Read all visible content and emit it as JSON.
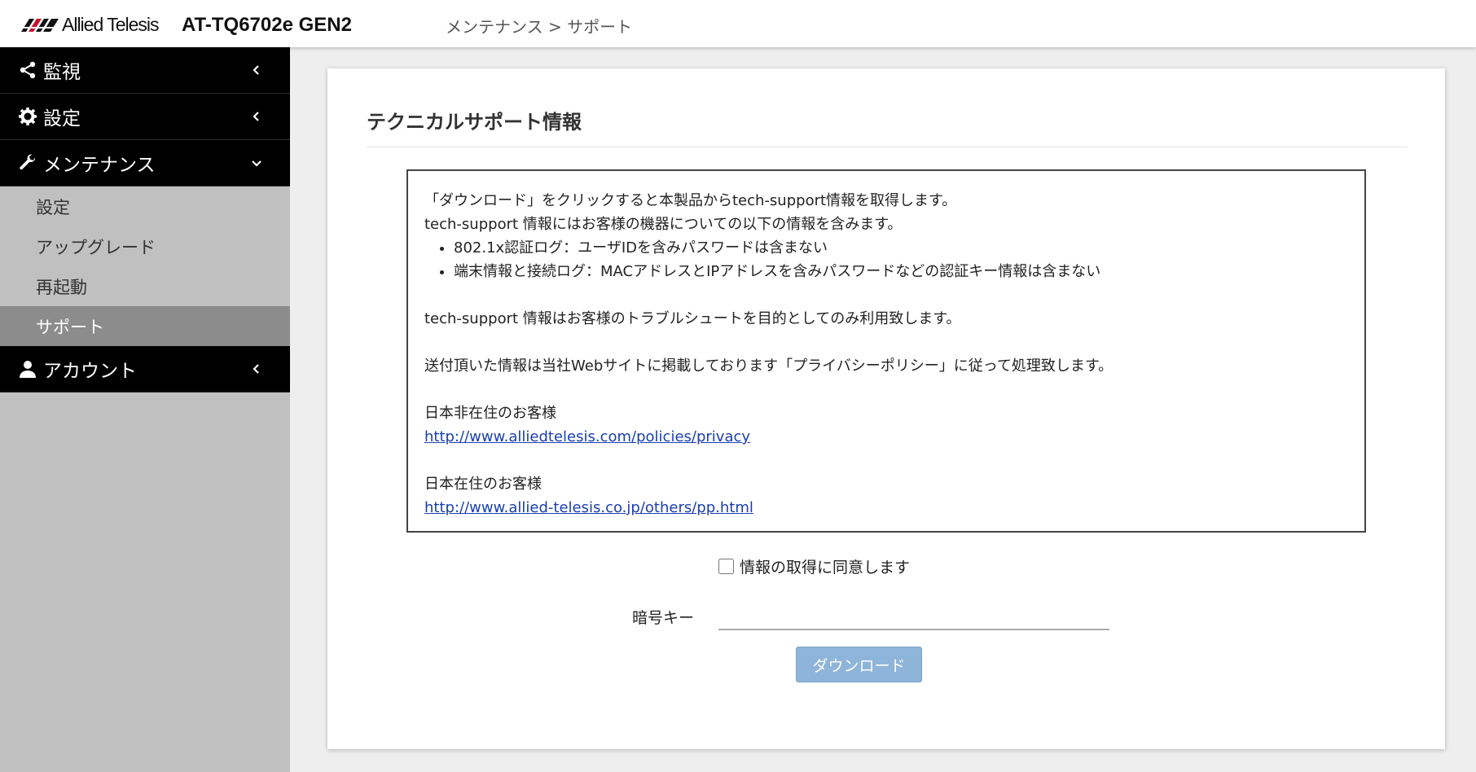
{
  "header": {
    "logo_text": "Allied Telesis",
    "device_name": "AT-TQ6702e GEN2",
    "breadcrumb": "メンテナンス > サポート"
  },
  "sidebar": {
    "items": [
      {
        "label": "監視",
        "icon": "share-icon",
        "expanded": false
      },
      {
        "label": "設定",
        "icon": "gear-icon",
        "expanded": false
      },
      {
        "label": "メンテナンス",
        "icon": "wrench-icon",
        "expanded": true,
        "children": [
          {
            "label": "設定"
          },
          {
            "label": "アップグレード"
          },
          {
            "label": "再起動"
          },
          {
            "label": "サポート",
            "active": true
          }
        ]
      },
      {
        "label": "アカウント",
        "icon": "user-icon",
        "expanded": false
      }
    ]
  },
  "main": {
    "title": "テクニカルサポート情報",
    "notice": {
      "line1": "「ダウンロード」をクリックすると本製品からtech-support情報を取得します。",
      "line2": "tech-support 情報にはお客様の機器についての以下の情報を含みます。",
      "bullets": [
        "802.1x認証ログ：ユーザIDを含みパスワードは含まない",
        "端末情報と接続ログ：MACアドレスとIPアドレスを含みパスワードなどの認証キー情報は含まない"
      ],
      "purpose": "tech-support 情報はお客様のトラブルシュートを目的としてのみ利用致します。",
      "policy": "送付頂いた情報は当社Webサイトに掲載しております「プライバシーポリシー」に従って処理致します。",
      "overseas_label": "日本非在住のお客様",
      "overseas_link": "http://www.alliedtelesis.com/policies/privacy",
      "domestic_label": "日本在住のお客様",
      "domestic_link": "http://www.allied-telesis.co.jp/others/pp.html"
    },
    "agree_label": "情報の取得に同意します",
    "agree_checked": false,
    "key_label": "暗号キー",
    "key_value": "",
    "download_label": "ダウンロード"
  },
  "colors": {
    "sidebar_bg": "#c0c0c0",
    "nav_bg": "#000000",
    "active_sub_bg": "#8c8c8c",
    "button_bg": "#8fb4d9",
    "link": "#1a3fb0"
  }
}
